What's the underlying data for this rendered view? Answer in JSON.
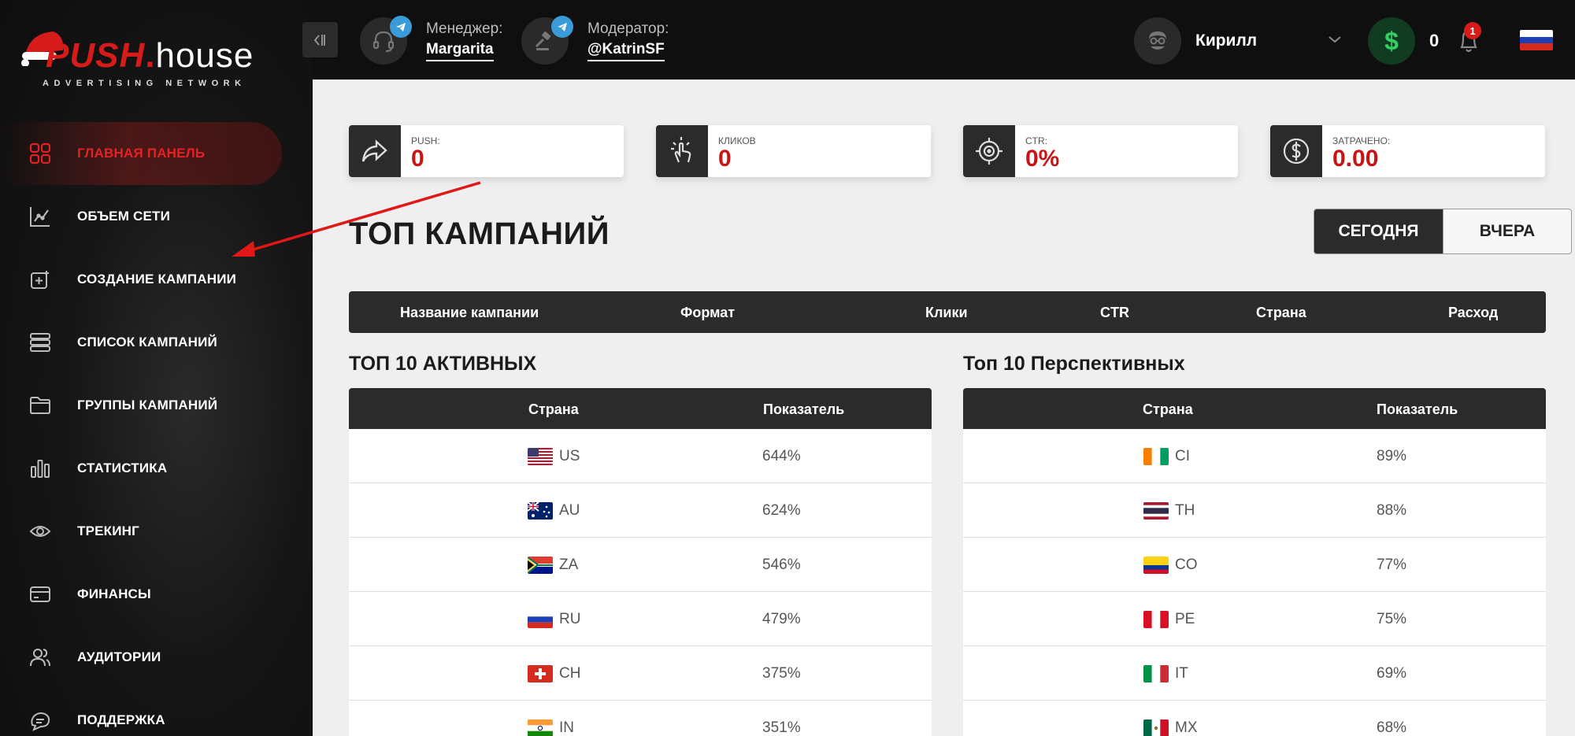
{
  "brand": {
    "push": "PUSH",
    "dot": ".",
    "house": "house",
    "tagline": "ADVERTISING NETWORK"
  },
  "nav": [
    {
      "label": "ГЛАВНАЯ ПАНЕЛЬ",
      "icon": "grid-icon",
      "active": true
    },
    {
      "label": "ОБЪЕМ СЕТИ",
      "icon": "chart-line-icon"
    },
    {
      "label": "СОЗДАНИЕ КАМПАНИИ",
      "icon": "add-square-icon"
    },
    {
      "label": "СПИСОК КАМПАНИЙ",
      "icon": "list-icon"
    },
    {
      "label": "ГРУППЫ КАМПАНИЙ",
      "icon": "folder-icon"
    },
    {
      "label": "СТАТИСТИКА",
      "icon": "bar-chart-icon"
    },
    {
      "label": "ТРЕКИНГ",
      "icon": "eye-icon"
    },
    {
      "label": "ФИНАНСЫ",
      "icon": "card-icon"
    },
    {
      "label": "АУДИТОРИИ",
      "icon": "users-icon"
    },
    {
      "label": "ПОДДЕРЖКА",
      "icon": "chat-icon"
    }
  ],
  "header": {
    "manager_role": "Менеджер:",
    "manager_name": "Margarita",
    "moderator_role": "Модератор:",
    "moderator_name": "@KatrinSF",
    "user_name": "Кирилл",
    "balance": "0",
    "notifications": "1",
    "currency_symbol": "$"
  },
  "stats": [
    {
      "label": "PUSH:",
      "value": "0",
      "icon": "share-arrow-icon"
    },
    {
      "label": "КЛИКОВ",
      "value": "0",
      "icon": "tap-hand-icon"
    },
    {
      "label": "CTR:",
      "value": "0%",
      "icon": "target-icon"
    },
    {
      "label": "ЗАТРАЧЕНО:",
      "value": "0.00",
      "icon": "dollar-circle-icon"
    }
  ],
  "top_campaigns": {
    "title": "ТОП КАМПАНИЙ",
    "today": "СЕГОДНЯ",
    "yesterday": "ВЧЕРА",
    "columns": [
      "Название кампании",
      "Формат",
      "Клики",
      "CTR",
      "Страна",
      "Расход"
    ]
  },
  "active": {
    "title": "ТОП 10 АКТИВНЫХ",
    "col_country": "Страна",
    "col_value": "Показатель",
    "rows": [
      {
        "code": "US",
        "value": "644%"
      },
      {
        "code": "AU",
        "value": "624%"
      },
      {
        "code": "ZA",
        "value": "546%"
      },
      {
        "code": "RU",
        "value": "479%"
      },
      {
        "code": "CH",
        "value": "375%"
      },
      {
        "code": "IN",
        "value": "351%"
      }
    ]
  },
  "perspective": {
    "title": "Топ 10 Перспективных",
    "col_country": "Страна",
    "col_value": "Показатель",
    "rows": [
      {
        "code": "CI",
        "value": "89%"
      },
      {
        "code": "TH",
        "value": "88%"
      },
      {
        "code": "CO",
        "value": "77%"
      },
      {
        "code": "PE",
        "value": "75%"
      },
      {
        "code": "IT",
        "value": "69%"
      },
      {
        "code": "MX",
        "value": "68%"
      }
    ]
  },
  "colors": {
    "accent": "#d61b1b",
    "dark": "#2b2b2b",
    "telegram": "#3a9bd9",
    "money": "#2fd267"
  }
}
